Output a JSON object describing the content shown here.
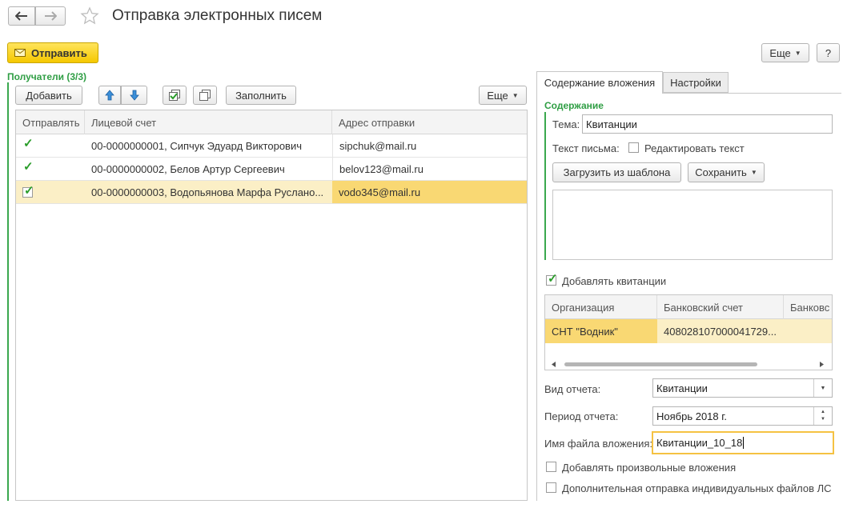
{
  "window": {
    "title": "Отправка электронных писем"
  },
  "toolbar": {
    "send_label": "Отправить",
    "more_label": "Еще",
    "help_label": "?"
  },
  "recipients": {
    "header": "Получатели (3/3)",
    "add_label": "Добавить",
    "fill_label": "Заполнить",
    "more_label": "Еще",
    "columns": [
      "Отправлять",
      "Лицевой счет",
      "Адрес отправки"
    ],
    "rows": [
      {
        "checked": true,
        "account": "00-0000000001, Сипчук Эдуард Викторович",
        "email": "sipchuk@mail.ru"
      },
      {
        "checked": true,
        "account": "00-0000000002, Белов Артур Сергеевич",
        "email": "belov123@mail.ru"
      },
      {
        "checked": true,
        "account": "00-0000000003, Водопьянова Марфа Руслано...",
        "email": "vodo345@mail.ru"
      }
    ]
  },
  "tabs": [
    "Содержание вложения",
    "Настройки"
  ],
  "content": {
    "section_title": "Содержание",
    "subject_label": "Тема:",
    "subject_value": "Квитанции",
    "body_label": "Текст письма:",
    "edit_text_label": "Редактировать текст",
    "load_template_label": "Загрузить из шаблона",
    "save_label": "Сохранить",
    "body_text": ""
  },
  "receipts": {
    "add_receipts_label": "Добавлять квитанции",
    "columns": [
      "Организация",
      "Банковский счет",
      "Банковс"
    ],
    "rows": [
      {
        "org": "СНТ \"Водник\"",
        "account": "408028107000041729..."
      }
    ]
  },
  "report": {
    "type_label": "Вид отчета:",
    "type_value": "Квитанции",
    "period_label": "Период отчета:",
    "period_value": "Ноябрь 2018 г.",
    "filename_label": "Имя файла вложения:",
    "filename_value": "Квитанции_10_18",
    "arbitrary_label": "Добавлять произвольные вложения",
    "individual_label": "Дополнительная отправка индивидуальных файлов ЛС"
  }
}
